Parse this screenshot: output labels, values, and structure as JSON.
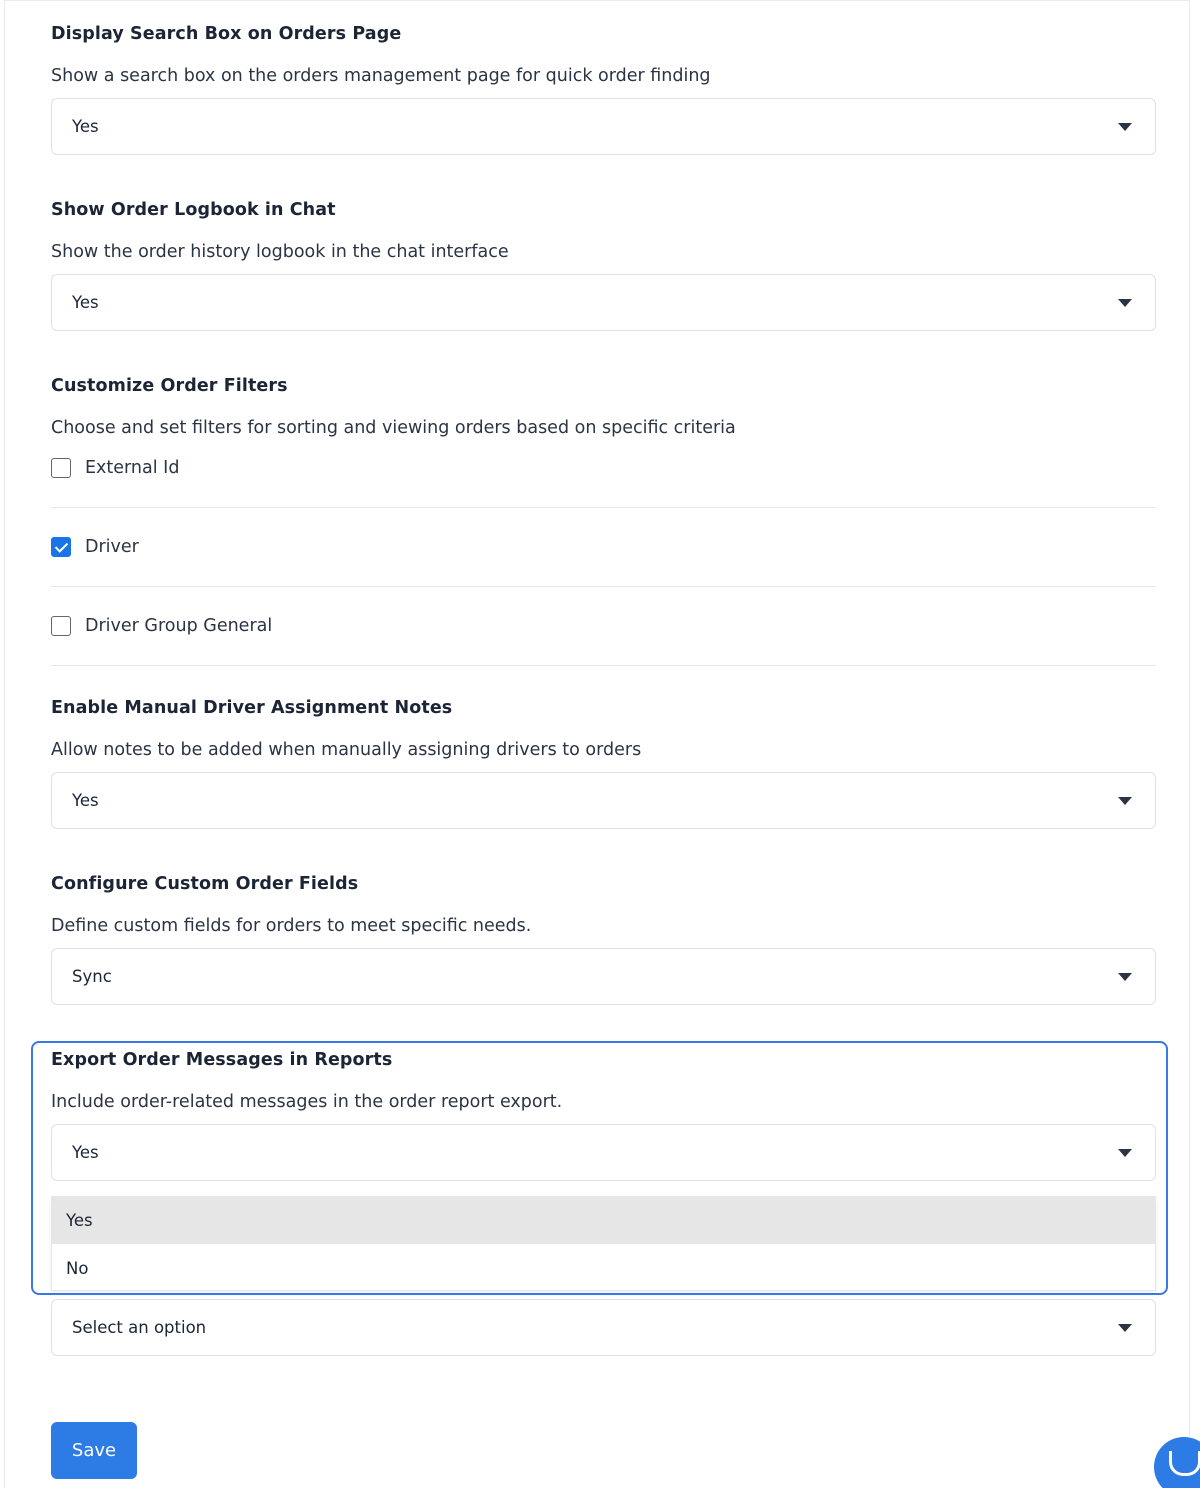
{
  "settings": [
    {
      "title": "Display Search Box on Orders Page",
      "description": "Show a search box on the orders management page for quick order finding",
      "value": "Yes"
    },
    {
      "title": "Show Order Logbook in Chat",
      "description": "Show the order history logbook in the chat interface",
      "value": "Yes"
    }
  ],
  "filters": {
    "title": "Customize Order Filters",
    "description": "Choose and set filters for sorting and viewing orders based on specific criteria",
    "options": [
      {
        "label": "External Id",
        "checked": false
      },
      {
        "label": "Driver",
        "checked": true
      },
      {
        "label": "Driver Group General",
        "checked": false
      }
    ]
  },
  "manual_notes": {
    "title": "Enable Manual Driver Assignment Notes",
    "description": "Allow notes to be added when manually assigning drivers to orders",
    "value": "Yes"
  },
  "custom_fields": {
    "title": "Configure Custom Order Fields",
    "description": "Define custom fields for orders to meet specific needs.",
    "value": "Sync"
  },
  "export_messages": {
    "title": "Export Order Messages in Reports",
    "description": "Include order-related messages in the order report export.",
    "value": "Yes",
    "options": [
      "Yes",
      "No"
    ]
  },
  "next_select": {
    "placeholder": "Select an option"
  },
  "save_label": "Save",
  "colors": {
    "accent": "#2d7be5",
    "focus_ring": "#3b78e7",
    "highlight": "#e6e6e6"
  }
}
